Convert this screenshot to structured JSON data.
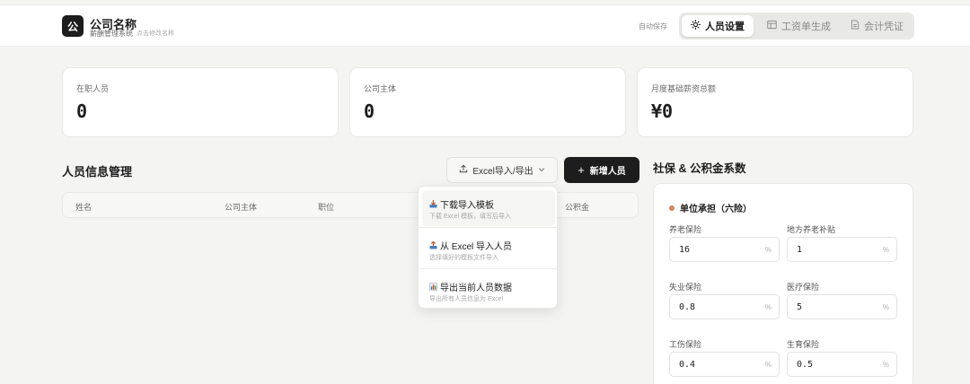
{
  "header": {
    "logo_char": "公",
    "company_name": "公司名称",
    "system_name": "薪酬管理系统",
    "edit_hint": "点击修改名称",
    "autosave": "自动保存",
    "tabs": [
      {
        "label": "人员设置",
        "icon": "gear-icon",
        "active": true
      },
      {
        "label": "工资单生成",
        "icon": "table-icon",
        "active": false
      },
      {
        "label": "会计凭证",
        "icon": "document-icon",
        "active": false
      }
    ]
  },
  "stats": [
    {
      "label": "在职人员",
      "value": "0"
    },
    {
      "label": "公司主体",
      "value": "0"
    },
    {
      "label": "月度基础薪资总额",
      "value": "¥0"
    }
  ],
  "personnel": {
    "title": "人员信息管理",
    "excel_button": "Excel导入/导出",
    "add_button": "新增人员",
    "columns": [
      "姓名",
      "公司主体",
      "职位",
      "公积金"
    ]
  },
  "excel_menu": [
    {
      "title": "下载导入模板",
      "desc": "下载 Excel 模板，填写后导入",
      "icon": "download-icon"
    },
    {
      "title": "从 Excel 导入人员",
      "desc": "选择填好的模板文件导入",
      "icon": "upload-icon"
    },
    {
      "title": "导出当前人员数据",
      "desc": "导出所有人员信息为 Excel",
      "icon": "bar-chart-icon"
    }
  ],
  "insurance": {
    "title": "社保 & 公积金系数",
    "group_title": "单位承担（六险）",
    "accent_color": "#d4845a",
    "unit": "%",
    "fields": [
      {
        "label": "养老保险",
        "value": "16"
      },
      {
        "label": "地方养老补贴",
        "value": "1"
      },
      {
        "label": "失业保险",
        "value": "0.8"
      },
      {
        "label": "医疗保险",
        "value": "5"
      },
      {
        "label": "工伤保险",
        "value": "0.4"
      },
      {
        "label": "生育保险",
        "value": "0.5"
      }
    ]
  }
}
